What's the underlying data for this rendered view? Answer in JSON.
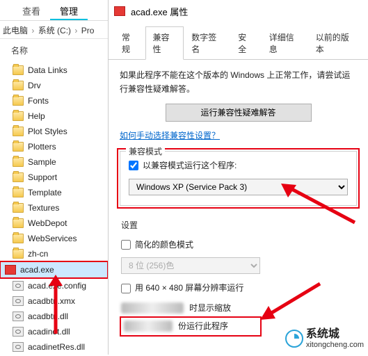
{
  "explorer": {
    "tabs": {
      "view": "查看",
      "manage": "管理"
    },
    "breadcrumb": {
      "pc": "此电脑",
      "drive": "系统 (C:)",
      "folder": "Pro"
    },
    "column": "名称",
    "items": [
      {
        "name": "Data Links",
        "type": "folder"
      },
      {
        "name": "Drv",
        "type": "folder"
      },
      {
        "name": "Fonts",
        "type": "folder"
      },
      {
        "name": "Help",
        "type": "folder"
      },
      {
        "name": "Plot Styles",
        "type": "folder"
      },
      {
        "name": "Plotters",
        "type": "folder"
      },
      {
        "name": "Sample",
        "type": "folder"
      },
      {
        "name": "Support",
        "type": "folder"
      },
      {
        "name": "Template",
        "type": "folder"
      },
      {
        "name": "Textures",
        "type": "folder"
      },
      {
        "name": "WebDepot",
        "type": "folder"
      },
      {
        "name": "WebServices",
        "type": "folder"
      },
      {
        "name": "zh-cn",
        "type": "folder"
      },
      {
        "name": "acad.exe",
        "type": "app"
      },
      {
        "name": "acad.exe.config",
        "type": "cfg"
      },
      {
        "name": "acadbtn.xmx",
        "type": "cfg"
      },
      {
        "name": "acadbtn.dll",
        "type": "cfg"
      },
      {
        "name": "acadinet.dll",
        "type": "cfg"
      },
      {
        "name": "acadinetRes.dll",
        "type": "cfg"
      }
    ]
  },
  "dlg": {
    "title": "acad.exe 属性",
    "tabs": {
      "general": "常规",
      "compat": "兼容性",
      "sig": "数字签名",
      "sec": "安全",
      "detail": "详细信息",
      "prev": "以前的版本"
    },
    "intro": "如果此程序不能在这个版本的 Windows 上正常工作，请尝试运行兼容性疑难解答。",
    "run_trouble": "运行兼容性疑难解答",
    "manual_link": "如何手动选择兼容性设置？",
    "compat_group": {
      "legend": "兼容模式",
      "checkbox": "以兼容模式运行这个程序:",
      "selected": "Windows XP (Service Pack 3)"
    },
    "settings_group": {
      "legend": "设置",
      "reduced_color": "简化的颜色模式",
      "color_select": "8 位 (256)色",
      "res640": "用 640 × 480 屏幕分辨率运行",
      "scale_text": "时显示缩放",
      "admin_text": "份运行此程序"
    }
  },
  "wm": {
    "brand": "系统城",
    "url": "xitongcheng.com"
  }
}
